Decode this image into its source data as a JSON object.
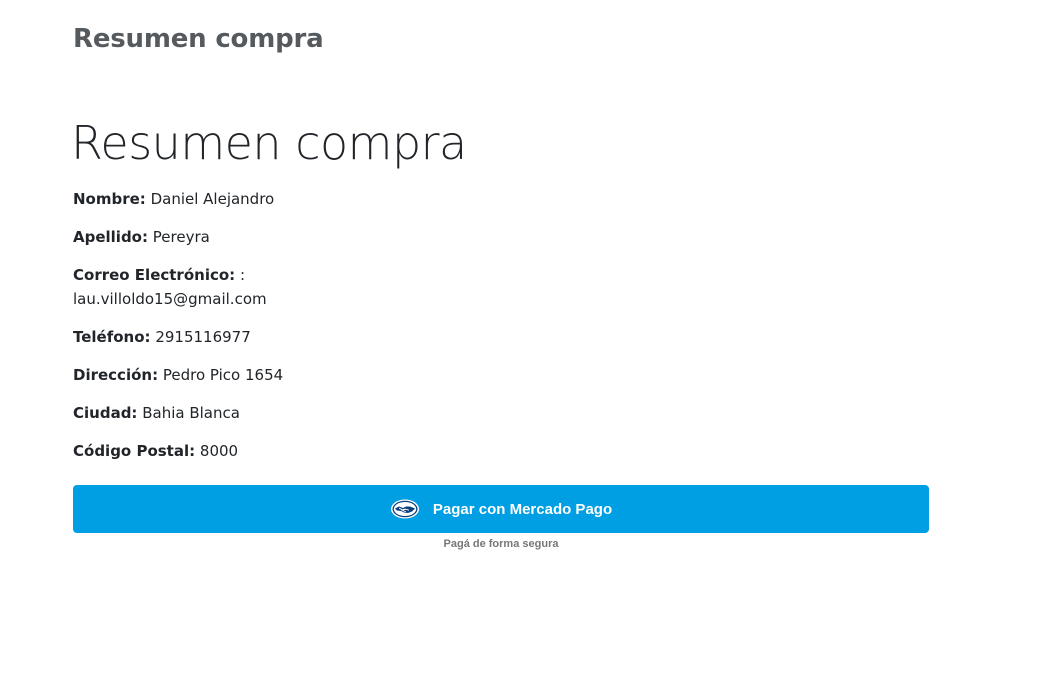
{
  "header": {
    "title": "Resumen compra"
  },
  "main": {
    "title": "Resumen compra",
    "fields": {
      "nombre": {
        "label": "Nombre:",
        "value": "Daniel Alejandro"
      },
      "apellido": {
        "label": "Apellido:",
        "value": "Pereyra"
      },
      "correo": {
        "label": "Correo Electrónico:",
        "value": ": lau.villoldo15@gmail.com"
      },
      "telefono": {
        "label": "Teléfono:",
        "value": "2915116977"
      },
      "direccion": {
        "label": "Dirección:",
        "value": "Pedro Pico 1654"
      },
      "ciudad": {
        "label": "Ciudad:",
        "value": "Bahia Blanca"
      },
      "codigo_postal": {
        "label": "Código Postal:",
        "value": "8000"
      }
    }
  },
  "payment": {
    "button_label": "Pagar con Mercado Pago",
    "button_icon": "mercadopago-handshake-icon",
    "secure_text": "Pagá de forma segura",
    "accent_color": "#009ee3"
  }
}
